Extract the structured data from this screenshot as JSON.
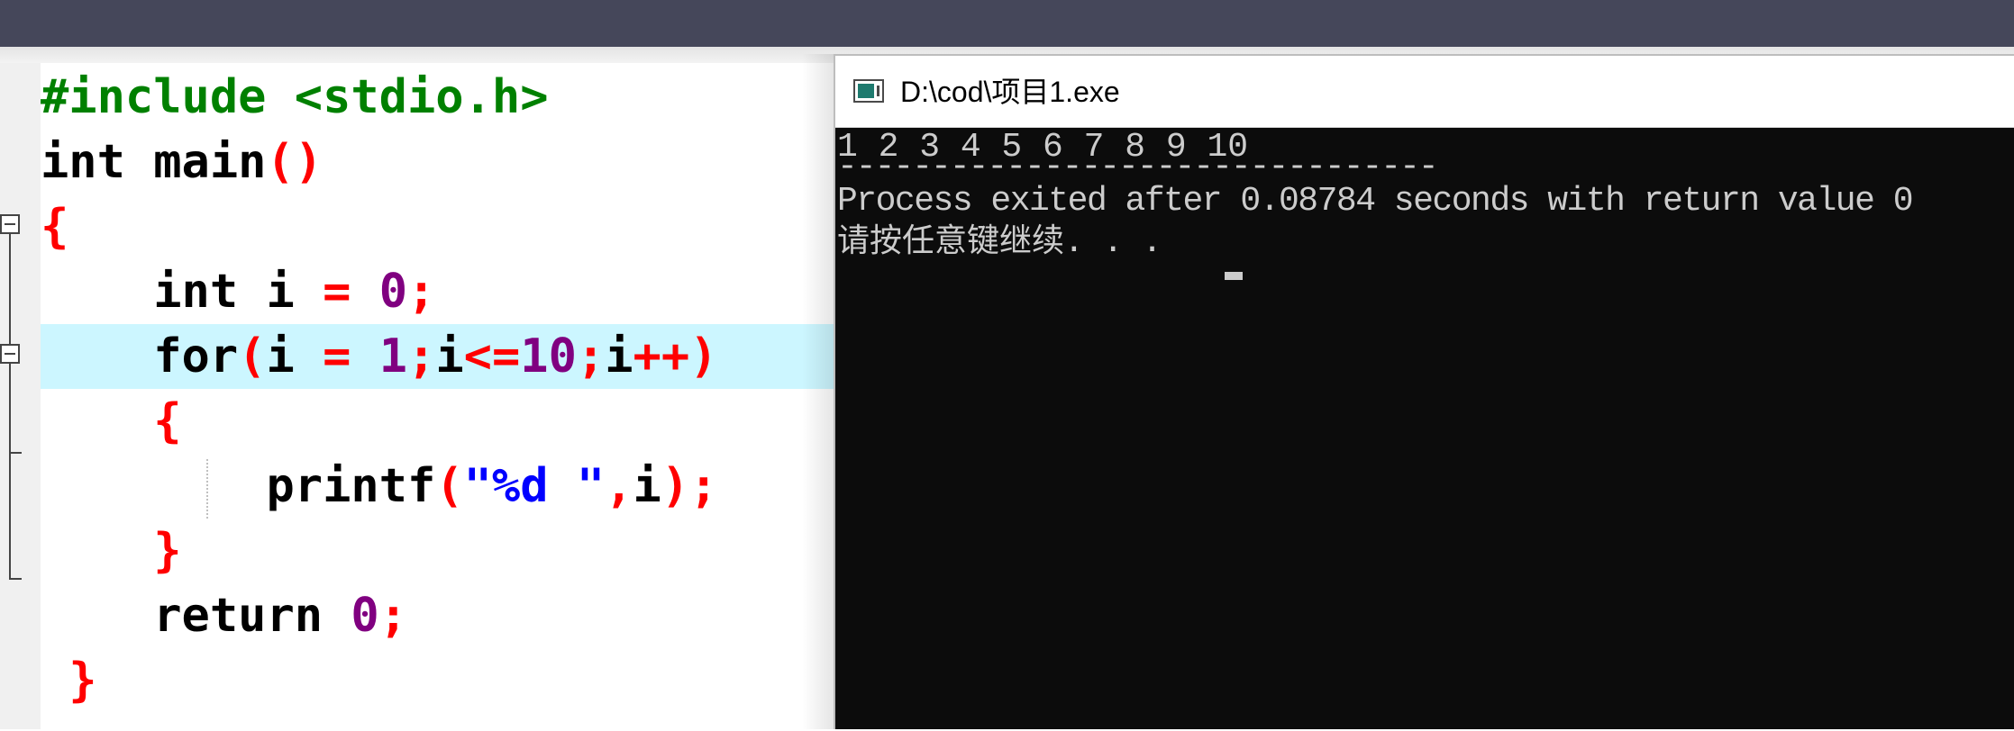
{
  "editor": {
    "lines": [
      [
        {
          "t": "#include <stdio.h>",
          "c": "pp"
        }
      ],
      [
        {
          "t": "int",
          "c": "kw"
        },
        {
          "t": " main",
          "c": "kw"
        },
        {
          "t": "()",
          "c": "op"
        }
      ],
      [
        {
          "t": "{",
          "c": "op"
        }
      ],
      [
        {
          "t": "    int",
          "c": "kw"
        },
        {
          "t": " i ",
          "c": "kw"
        },
        {
          "t": "=",
          "c": "op"
        },
        {
          "t": " ",
          "c": "kw"
        },
        {
          "t": "0",
          "c": "num"
        },
        {
          "t": ";",
          "c": "op"
        }
      ],
      [
        {
          "t": "    for",
          "c": "kw"
        },
        {
          "t": "(",
          "c": "op"
        },
        {
          "t": "i ",
          "c": "kw"
        },
        {
          "t": "=",
          "c": "op"
        },
        {
          "t": " ",
          "c": "kw"
        },
        {
          "t": "1",
          "c": "num"
        },
        {
          "t": ";",
          "c": "op"
        },
        {
          "t": "i",
          "c": "kw"
        },
        {
          "t": "<=",
          "c": "op"
        },
        {
          "t": "10",
          "c": "num"
        },
        {
          "t": ";",
          "c": "op"
        },
        {
          "t": "i",
          "c": "kw"
        },
        {
          "t": "++)",
          "c": "op"
        }
      ],
      [
        {
          "t": "    {",
          "c": "op"
        }
      ],
      [
        {
          "t": "        printf",
          "c": "kw"
        },
        {
          "t": "(",
          "c": "op"
        },
        {
          "t": "\"%d \"",
          "c": "str"
        },
        {
          "t": ",",
          "c": "op"
        },
        {
          "t": "i",
          "c": "kw"
        },
        {
          "t": ");",
          "c": "op"
        }
      ],
      [
        {
          "t": "    }",
          "c": "op"
        }
      ],
      [
        {
          "t": "    return",
          "c": "kw"
        },
        {
          "t": " ",
          "c": "kw"
        },
        {
          "t": "0",
          "c": "num"
        },
        {
          "t": ";",
          "c": "op"
        }
      ],
      [
        {
          "t": " }",
          "c": "op"
        }
      ]
    ],
    "active_line": 4,
    "colors": {
      "preprocessor": "#008000",
      "keyword": "#000000",
      "operator": "#ff0000",
      "number": "#800080",
      "string": "#0000ff",
      "active_line_bg": "#ccf6ff"
    }
  },
  "console": {
    "title": "D:\\cod\\项目1.exe",
    "icon": "console-window-icon",
    "output_lines": [
      "1 2 3 4 5 6 7 8 9 10",
      "--------------------------------",
      "Process exited after 0.08784 seconds with return value 0",
      "请按任意键继续. . . "
    ],
    "colors": {
      "background": "#0c0c0c",
      "text": "#cccccc"
    }
  }
}
